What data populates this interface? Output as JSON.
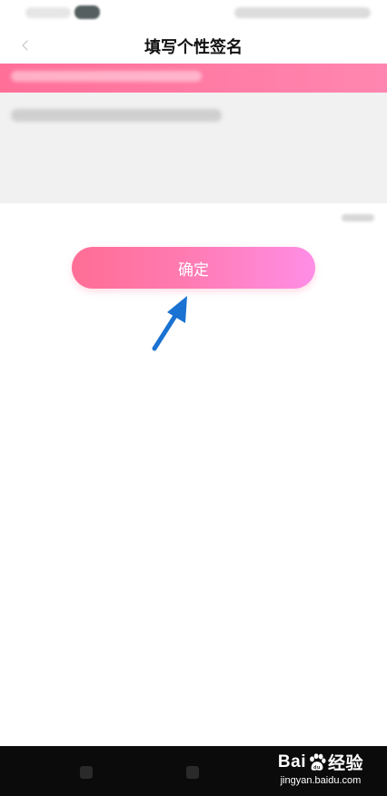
{
  "header": {
    "title": "填写个性签名"
  },
  "actions": {
    "confirm_label": "确定"
  },
  "watermark": {
    "brand_left": "Bai",
    "brand_right": "经验",
    "site": "jingyan.baidu.com"
  },
  "colors": {
    "accent_start": "#ff6e95",
    "accent_end": "#ff8ee6",
    "annotation_arrow": "#1a72d2",
    "nav_bar": "#0b0b0b"
  },
  "icons": {
    "back": "back-arrow-icon",
    "annotation": "blue-arrow-icon",
    "watermark": "baidu-paw-icon"
  }
}
